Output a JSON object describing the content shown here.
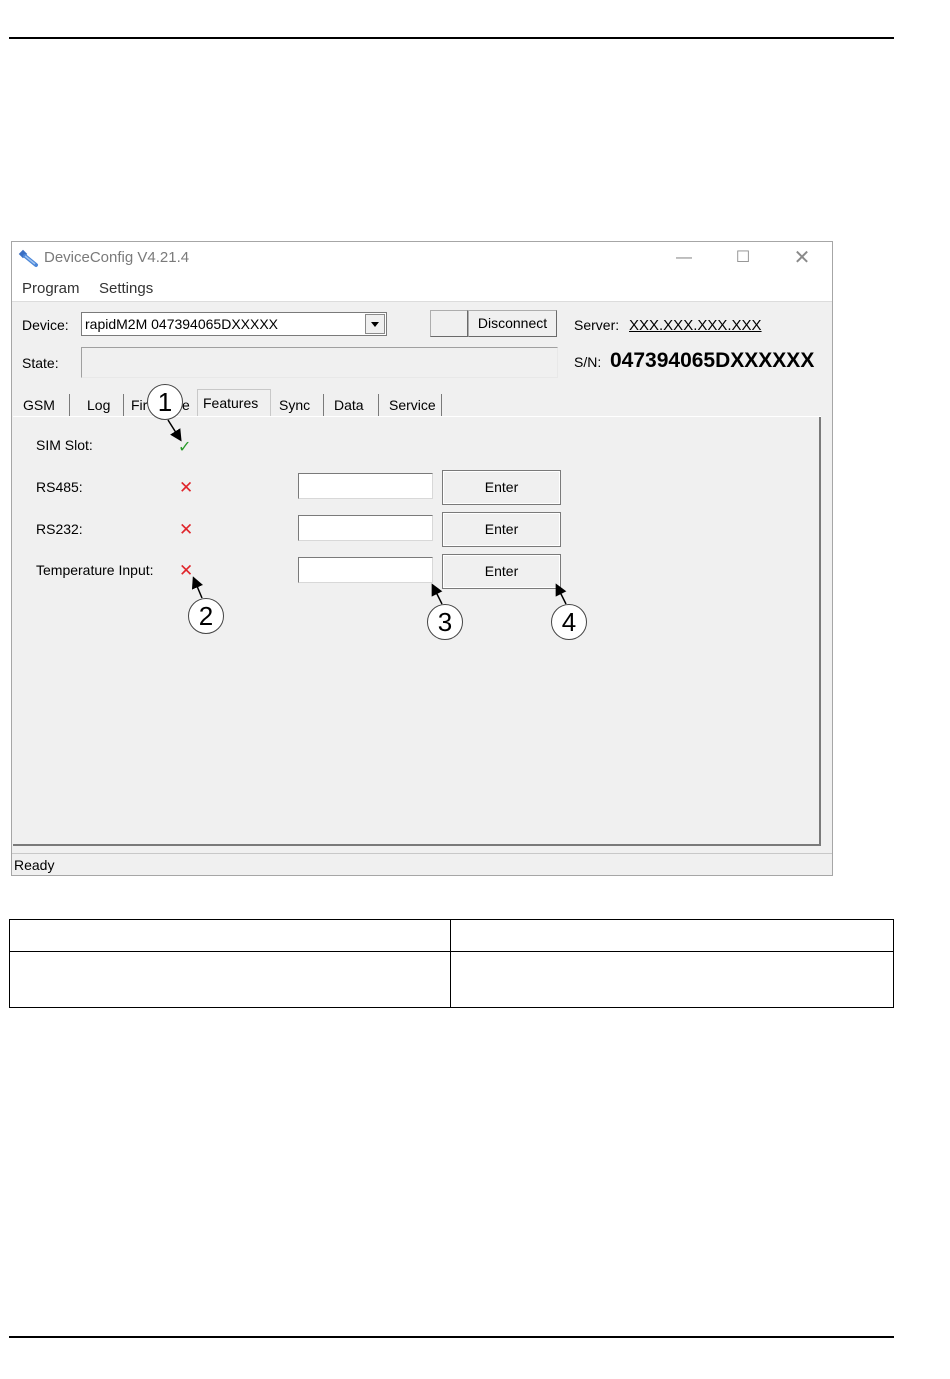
{
  "window": {
    "title": "DeviceConfig V4.21.4",
    "controls": {
      "minimize": "—",
      "maximize": "☐",
      "close": "✕"
    }
  },
  "menu": {
    "items": [
      "Program",
      "Settings"
    ]
  },
  "device": {
    "label": "Device:",
    "selected": "rapidM2M 047394065DXXXXX",
    "disconnect_label": "Disconnect"
  },
  "server": {
    "label": "Server:",
    "value": "XXX.XXX.XXX.XXX"
  },
  "state": {
    "label": "State:",
    "value": ""
  },
  "sn": {
    "label": "S/N:",
    "value": "047394065DXXXXXX"
  },
  "tabs": [
    {
      "label": "GSM"
    },
    {
      "label": "Log"
    },
    {
      "label": "Fir"
    },
    {
      "label": "e"
    },
    {
      "label": "Features",
      "active": true
    },
    {
      "label": "Sync"
    },
    {
      "label": "Data"
    },
    {
      "label": "Service"
    }
  ],
  "features": [
    {
      "label": "SIM Slot:",
      "status": "✓",
      "status_icon": "check-icon",
      "editable": false
    },
    {
      "label": "RS485:",
      "status": "✕",
      "status_icon": "x-icon",
      "editable": true,
      "value": "",
      "button": "Enter"
    },
    {
      "label": "RS232:",
      "status": "✕",
      "status_icon": "x-icon",
      "editable": true,
      "value": "",
      "button": "Enter"
    },
    {
      "label": "Temperature Input:",
      "status": "✕",
      "status_icon": "x-icon",
      "editable": true,
      "value": "",
      "button": "Enter"
    }
  ],
  "statusbar": {
    "text": "Ready"
  },
  "callouts": [
    "1",
    "2",
    "3",
    "4"
  ],
  "colors": {
    "ok": "#2a9a2a",
    "error": "#e0252b",
    "window_bg": "#f0f0f0"
  }
}
